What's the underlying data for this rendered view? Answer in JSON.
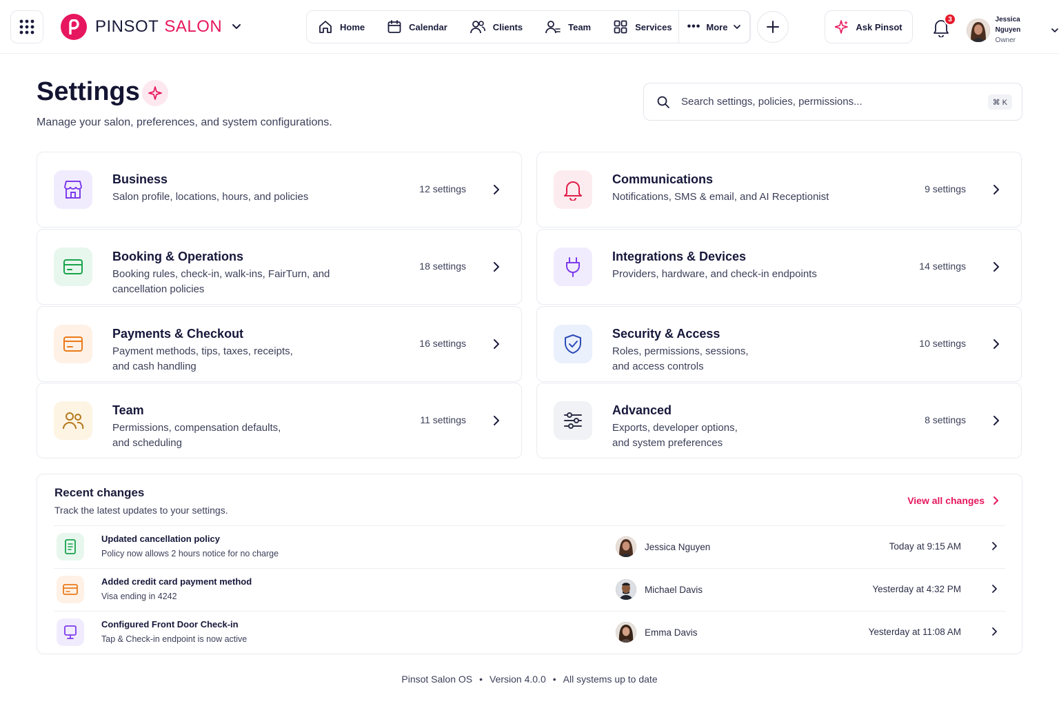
{
  "brand": {
    "name": "PINSOT",
    "accent": "SALON",
    "color": "#e6175e"
  },
  "nav": {
    "items": [
      "Home",
      "Calendar",
      "Clients",
      "Team",
      "Services"
    ],
    "more_label": "More"
  },
  "ask_label": "Ask Pinsot",
  "notifications": {
    "count": "3"
  },
  "user": {
    "name": "Jessica Nguyen",
    "role": "Owner"
  },
  "header": {
    "title": "Settings",
    "subtitle": "Manage your salon, preferences, and system configurations."
  },
  "search": {
    "placeholder": "Search settings, policies, permissions...",
    "shortcut": "⌘ K"
  },
  "cards": [
    {
      "title": "Business",
      "desc1": "Salon profile, locations, hours, and policies",
      "desc2": "",
      "count": "12 settings",
      "icon": "storefront-icon"
    },
    {
      "title": "Communications",
      "desc1": "Notifications, SMS & email, and AI Receptionist",
      "desc2": "",
      "count": "9 settings",
      "icon": "bell-icon"
    },
    {
      "title": "Booking & Operations",
      "desc1": "Booking rules, check-in, walk-ins, FairTurn, and",
      "desc2": "cancellation policies",
      "count": "18 settings",
      "icon": "card-icon"
    },
    {
      "title": "Integrations & Devices",
      "desc1": "Providers, hardware, and check-in endpoints",
      "desc2": "",
      "count": "14 settings",
      "icon": "plug-icon"
    },
    {
      "title": "Payments & Checkout",
      "desc1": "Payment methods, tips, taxes, receipts,",
      "desc2": "and cash handling",
      "count": "16 settings",
      "icon": "credit-card-icon"
    },
    {
      "title": "Security & Access",
      "desc1": "Roles, permissions, sessions,",
      "desc2": "and access controls",
      "count": "10 settings",
      "icon": "shield-icon"
    },
    {
      "title": "Team",
      "desc1": "Permissions, compensation defaults,",
      "desc2": "and scheduling",
      "count": "11 settings",
      "icon": "people-icon"
    },
    {
      "title": "Advanced",
      "desc1": "Exports, developer options,",
      "desc2": "and system preferences",
      "count": "8 settings",
      "icon": "sliders-icon"
    }
  ],
  "recent": {
    "title": "Recent changes",
    "subtitle": "Track the latest updates to your settings.",
    "view_all": "View all changes",
    "rows": [
      {
        "title": "Updated cancellation policy",
        "desc": "Policy now allows 2 hours notice for no charge",
        "user": "Jessica Nguyen",
        "time": "Today at 9:15 AM"
      },
      {
        "title": "Added credit card payment method",
        "desc": "Visa ending in 4242",
        "user": "Michael Davis",
        "time": "Yesterday at 4:32 PM"
      },
      {
        "title": "Configured Front Door Check-in",
        "desc": "Tap & Check-in endpoint is now active",
        "user": "Emma Davis",
        "time": "Yesterday at 11:08 AM"
      }
    ]
  },
  "footer": {
    "product": "Pinsot Salon OS",
    "version": "Version 4.0.0",
    "status": "All systems up to date"
  }
}
